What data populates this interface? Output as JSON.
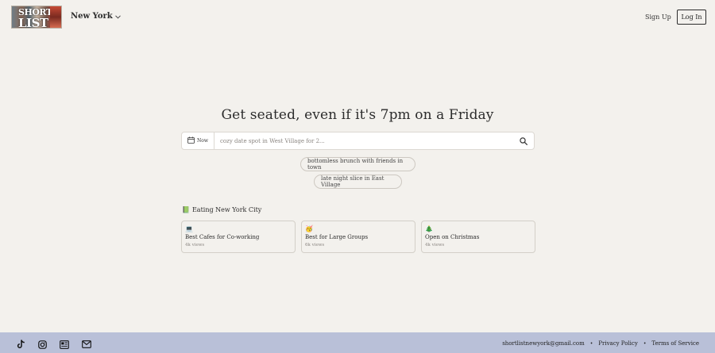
{
  "header": {
    "logo_line1": "SHORT",
    "logo_line2": "LIST",
    "city": "New York",
    "signup_label": "Sign Up",
    "login_label": "Log In"
  },
  "hero": {
    "title": "Get seated, even if it's 7pm on a Friday",
    "date_label": "Now",
    "search_placeholder": "cozy date spot in West Village for 2...",
    "suggestions": [
      "bottomless brunch with friends in town",
      "late night slice in East Village"
    ]
  },
  "section": {
    "icon": "📗",
    "title": "Eating New York City",
    "cards": [
      {
        "emoji": "💻",
        "title": "Best Cafes for Co-working",
        "views": "4k views"
      },
      {
        "emoji": "🥳",
        "title": "Best for Large Groups",
        "views": "6k views"
      },
      {
        "emoji": "🎄",
        "title": "Open on Christmas",
        "views": "4k views"
      }
    ]
  },
  "footer": {
    "email": "shortlistnewyork@gmail.com",
    "privacy": "Privacy Policy",
    "terms": "Terms of Service",
    "separator": "•"
  },
  "colors": {
    "background": "#f3f1ed",
    "footer": "#b9c0d8",
    "text": "#2c2c2c"
  }
}
